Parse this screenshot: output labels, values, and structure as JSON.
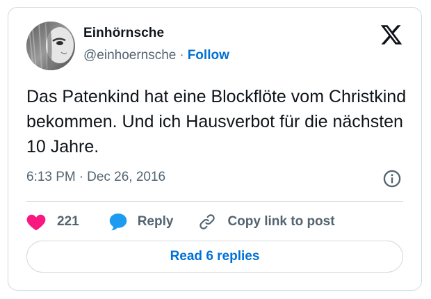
{
  "author": {
    "display_name": "Einhörnsche",
    "handle": "@einhoernsche",
    "separator": "·",
    "follow_label": "Follow"
  },
  "tweet": {
    "text": "Das Patenkind hat eine Blockflöte vom Christkind bekommen. Und ich Hausverbot für die nächsten 10 Jahre.",
    "time": "6:13 PM",
    "separator": "·",
    "date": "Dec 26, 2016"
  },
  "actions": {
    "like_count": "221",
    "reply_label": "Reply",
    "copy_link_label": "Copy link to post"
  },
  "footer": {
    "read_replies_label": "Read 6 replies"
  },
  "colors": {
    "like": "#f91880",
    "reply": "#1d9bf0",
    "link": "#006fd6",
    "text": "#0f1419",
    "muted": "#536471",
    "border": "#cfd9de"
  },
  "icons": {
    "brand": "x-logo-icon",
    "info": "info-icon",
    "like": "heart-icon",
    "reply": "speech-bubble-icon",
    "copy": "link-icon"
  }
}
